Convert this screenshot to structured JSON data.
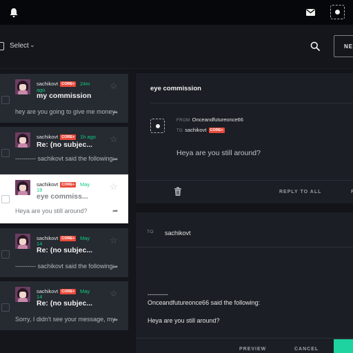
{
  "topbar": {
    "icons": [
      "bell-icon",
      "mail-icon",
      "avatar-icon"
    ]
  },
  "toolbar": {
    "select_label": "Select",
    "select_chevron": "⌄",
    "new_label": "NEW"
  },
  "messages": [
    {
      "author": "sachikovt",
      "badge": "CORE+",
      "time_line1": "24m",
      "time_line2": "ago",
      "subject": "my commission",
      "preview": "hey are you going to give me money",
      "selected": false
    },
    {
      "author": "sachikovt",
      "badge": "CORE+",
      "time_line1": "1h ago",
      "time_line2": "",
      "subject": "Re: (no subjec...",
      "preview": "---------- sachikovt said the following:",
      "selected": false
    },
    {
      "author": "sachikovt",
      "badge": "CORE+",
      "time_line1": "May",
      "time_line2": "18",
      "subject": "eye commiss...",
      "preview": "Heya are you still around?",
      "selected": true
    },
    {
      "author": "sachikovt",
      "badge": "CORE+",
      "time_line1": "May",
      "time_line2": "14",
      "subject": "Re: (no subjec...",
      "preview": "---------- sachikovt said the following:",
      "selected": false
    },
    {
      "author": "sachikovt",
      "badge": "CORE+",
      "time_line1": "May",
      "time_line2": "14",
      "subject": "Re: (no subjec...",
      "preview": "Sorry, I didn't see your message, my",
      "selected": false
    }
  ],
  "reader": {
    "subject": "eye commission",
    "from_label": "FROM",
    "from_value": "Onceandfutureonce66",
    "to_label": "TO",
    "to_value": "sachikovt",
    "to_badge": "CORE+",
    "body": "Heya are you still around?",
    "reply_all_label": "REPLY TO ALL",
    "reply_label": "R"
  },
  "compose": {
    "to_label": "TO",
    "to_value": "sachikovt",
    "separator": "----------",
    "quote_header": "Onceandfutureonce66 said the following:",
    "quote_body": "Heya are you still around?",
    "preview_label": "PREVIEW",
    "cancel_label": "CANCEL"
  },
  "colors": {
    "accent_green": "#0ecb81",
    "core_badge": "#e94b3c",
    "send_button": "#1ed3a0"
  }
}
